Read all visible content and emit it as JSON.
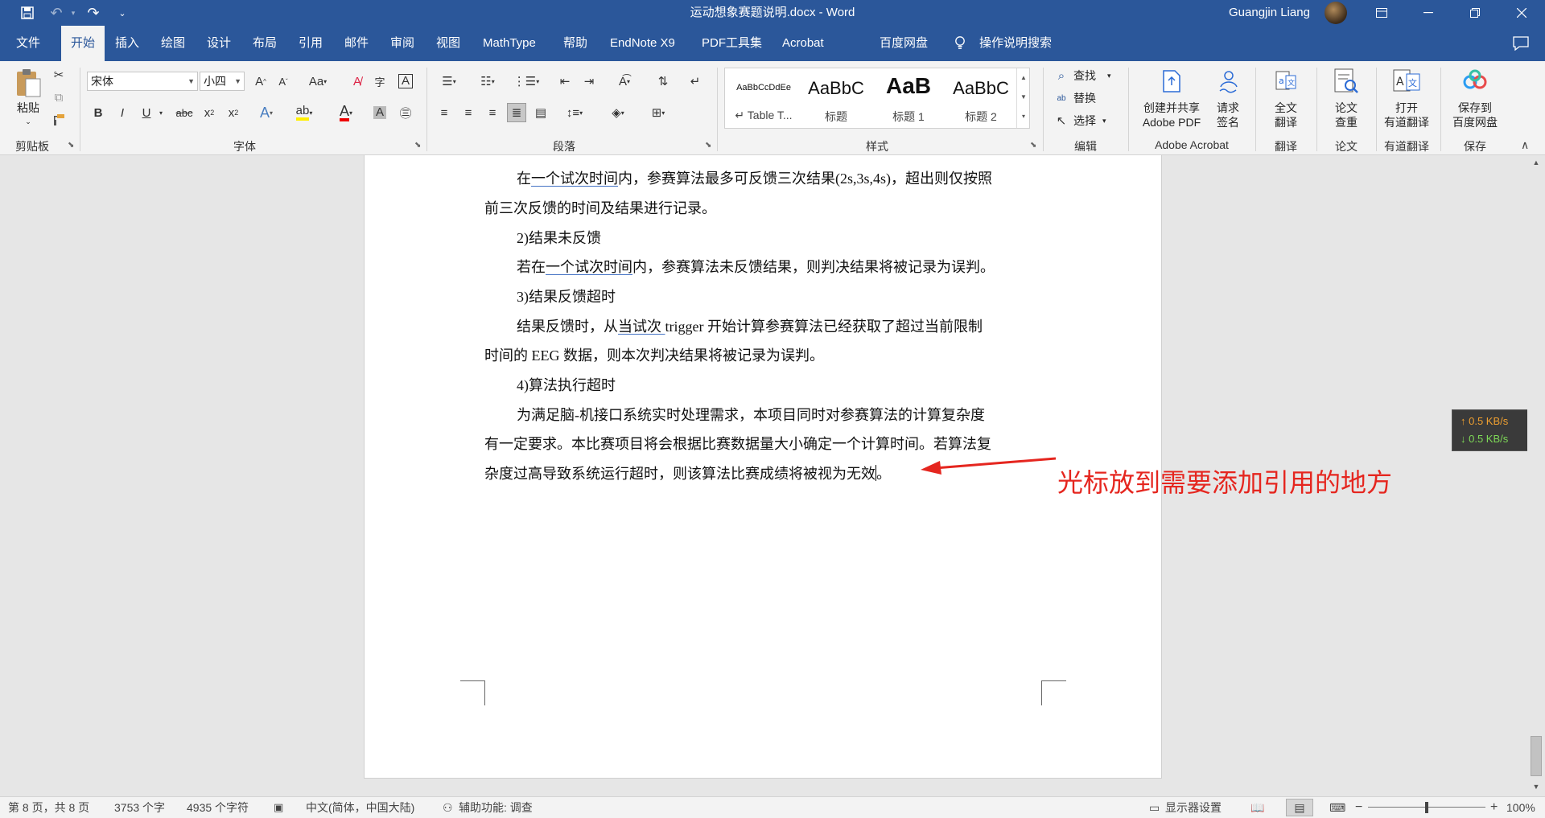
{
  "titlebar": {
    "document_title": "运动想象赛题说明.docx - Word",
    "user_name": "Guangjin Liang",
    "bg_color": "#2b579a"
  },
  "tabs": [
    "文件",
    "开始",
    "插入",
    "绘图",
    "设计",
    "布局",
    "引用",
    "邮件",
    "审阅",
    "视图",
    "MathType",
    "帮助",
    "EndNote X9",
    "PDF工具集",
    "Acrobat",
    "百度网盘"
  ],
  "tell_me": "操作说明搜索",
  "ribbon": {
    "clipboard": {
      "paste_label": "粘贴",
      "group_label": "剪贴板"
    },
    "font": {
      "font_name": "宋体",
      "font_size": "小四",
      "group_label": "字体"
    },
    "paragraph": {
      "group_label": "段落"
    },
    "styles": {
      "group_label": "样式",
      "items": [
        {
          "preview": "AaBbCcDdEe",
          "name": "↵ Table T..."
        },
        {
          "preview": "AaBbC",
          "name": "标题"
        },
        {
          "preview": "AaB",
          "name": "标题 1"
        },
        {
          "preview": "AaBbC",
          "name": "标题 2"
        }
      ]
    },
    "editing": {
      "find": "查找",
      "replace": "替换",
      "select": "选择",
      "group_label": "编辑"
    },
    "acrobat": {
      "create_line1": "创建并共享",
      "create_line2": "Adobe PDF",
      "sign_line1": "请求",
      "sign_line2": "签名",
      "group_label": "Adobe Acrobat"
    },
    "translate": {
      "line1": "全文",
      "line2": "翻译",
      "group_label": "翻译"
    },
    "paper": {
      "line1": "论文",
      "line2": "查重",
      "group_label": "论文"
    },
    "youdao": {
      "line1": "打开",
      "line2": "有道翻译",
      "group_label": "有道翻译"
    },
    "save": {
      "line1": "保存到",
      "line2": "百度网盘",
      "group_label": "保存"
    }
  },
  "document": {
    "p1a_pre": "在",
    "p1a_link": "一个试次时间",
    "p1a_post": "内，参赛算法最多可反馈三次结果(2s,3s,4s)，超出则仅按照",
    "p1b": "前三次反馈的时间及结果进行记录。",
    "h2": "2)结果未反馈",
    "p2_pre": "若在",
    "p2_link": "一个试次时间",
    "p2_post": "内，参赛算法未反馈结果，则判决结果将被记录为误判。",
    "h3": "3)结果反馈超时",
    "p3a_pre": "结果反馈时，从",
    "p3a_link": "当试次 ",
    "p3a_post": "trigger  开始计算参赛算法已经获取了超过当前限制",
    "p3b": "时间的 EEG 数据，则本次判决结果将被记录为误判。",
    "h4": "4)算法执行超时",
    "p4a": "为满足脑-机接口系统实时处理需求，本项目同时对参赛算法的计算复杂度",
    "p4b": "有一定要求。本比赛项目将会根据比赛数据量大小确定一个计算时间。若算法复",
    "p4c_pre": "杂度过高导致系统运行超时，则该算法比赛成绩将被视为无效",
    "p4c_post": "。"
  },
  "annotation": {
    "text": "光标放到需要添加引用的地方",
    "color": "#e5261f"
  },
  "network": {
    "upload": "↑ 0.5 KB/s",
    "download": "↓ 0.5 KB/s",
    "upload_color": "#f0a030",
    "download_color": "#7ed957"
  },
  "statusbar": {
    "page": "第 8 页，共 8 页",
    "words": "3753 个字",
    "chars": "4935 个字符",
    "language": "中文(简体，中国大陆)",
    "accessibility": "辅助功能: 调查",
    "display_settings": "显示器设置",
    "zoom": "100%"
  }
}
